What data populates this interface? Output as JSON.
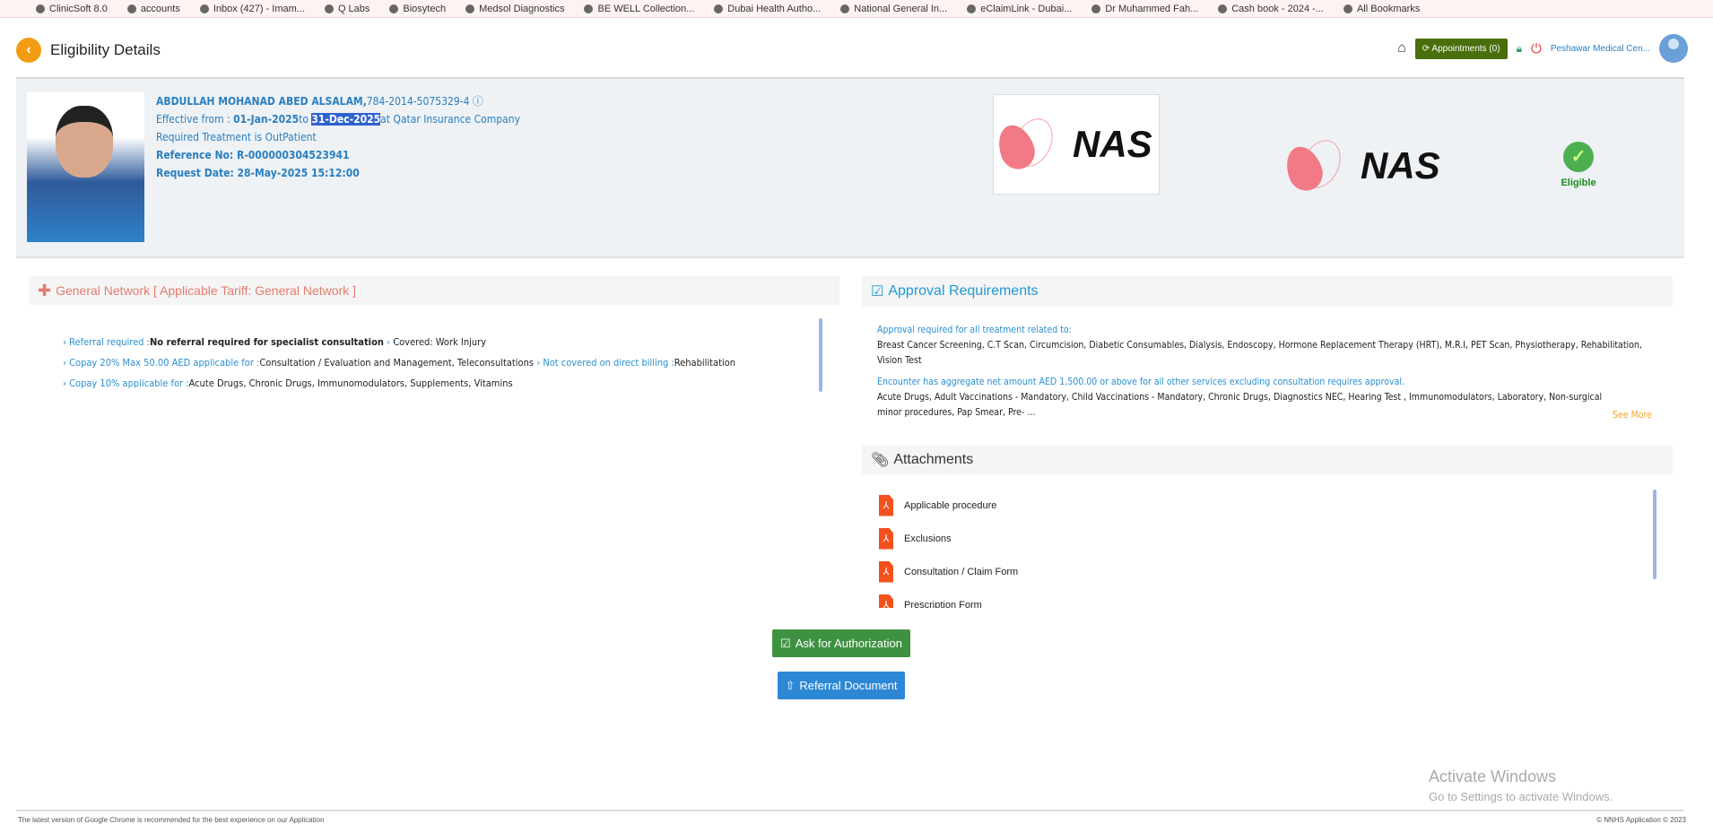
{
  "bookmarks": [
    "ClinicSoft 8.0",
    "accounts",
    "Inbox (427) - Imam...",
    "Q Labs",
    "Biosytech",
    "Medsol Diagnostics",
    "BE WELL Collection...",
    "Dubai Health Autho...",
    "National General In...",
    "eClaimLink - Dubai...",
    "Dr Muhammed Fah...",
    "Cash book - 2024 -...",
    "All Bookmarks"
  ],
  "header": {
    "title": "Eligibility Details",
    "appointments": "Appointments (0)",
    "facility": "Peshawar Medical Cen..."
  },
  "patient": {
    "name": "ABDULLAH MOHANAD ABED ALSALAM,",
    "id": "784-2014-5075329-4",
    "effective_label": "Effective from : ",
    "from": "01-Jan-2025",
    "to_word": "to ",
    "to": "31-Dec-2025",
    "insurer": "at Qatar Insurance Company",
    "treatment": "Required Treatment is OutPatient",
    "reference": "Reference No: R-000000304523941",
    "request_date": "Request Date: 28-May-2025 15:12:00"
  },
  "logo_text": "NAS",
  "status": "Eligible",
  "network": {
    "title": "General Network [ Applicable Tariff: General Network ]",
    "lines": [
      [
        {
          "k": "Referral required :",
          "v": "No referral required for specialist consultation",
          "bold": true
        },
        {
          "k": "",
          "v": "Covered: Work Injury"
        }
      ],
      [
        {
          "k": "Copay 20% Max 50.00 AED applicable for :",
          "v": "Consultation / Evaluation and Management, Teleconsultations"
        },
        {
          "k": "Not covered on direct billing :",
          "v": "Rehabilitation"
        }
      ],
      [
        {
          "k": "Copay 10% applicable for :",
          "v": "Acute Drugs, Chronic Drugs, Immunomodulators, Supplements, Vitamins"
        }
      ]
    ]
  },
  "approval": {
    "title": "Approval Requirements",
    "h1": "Approval required for all treatment related to:",
    "t1": "Breast Cancer Screening, C.T Scan, Circumcision, Diabetic Consumables, Dialysis, Endoscopy, Hormone Replacement Therapy (HRT), M.R.I, PET Scan, Physiotherapy, Rehabilitation, Vision Test",
    "h2": "Encounter has aggregate net amount AED 1,500.00 or above for all other services excluding consultation requires approval.",
    "t2": "Acute Drugs, Adult Vaccinations - Mandatory, Child Vaccinations - Mandatory, Chronic Drugs, Diagnostics NEC, Hearing Test , Immunomodulators, Laboratory, Non-surgical minor procedures, Pap Smear, Pre- ...",
    "see_more": "See More"
  },
  "attachments": {
    "title": "Attachments",
    "items": [
      "Applicable procedure",
      "Exclusions",
      "Consultation / Claim Form",
      "Prescription Form"
    ]
  },
  "buttons": {
    "ask": "Ask for Authorization",
    "referral": "Referral Document"
  },
  "watermark": {
    "l1": "Activate Windows",
    "l2": "Go to Settings to activate Windows."
  },
  "footer": {
    "left": "The latest version of Google Chrome is recommended for the best experience on our Application",
    "right": "© NNHS Application © 2023"
  }
}
